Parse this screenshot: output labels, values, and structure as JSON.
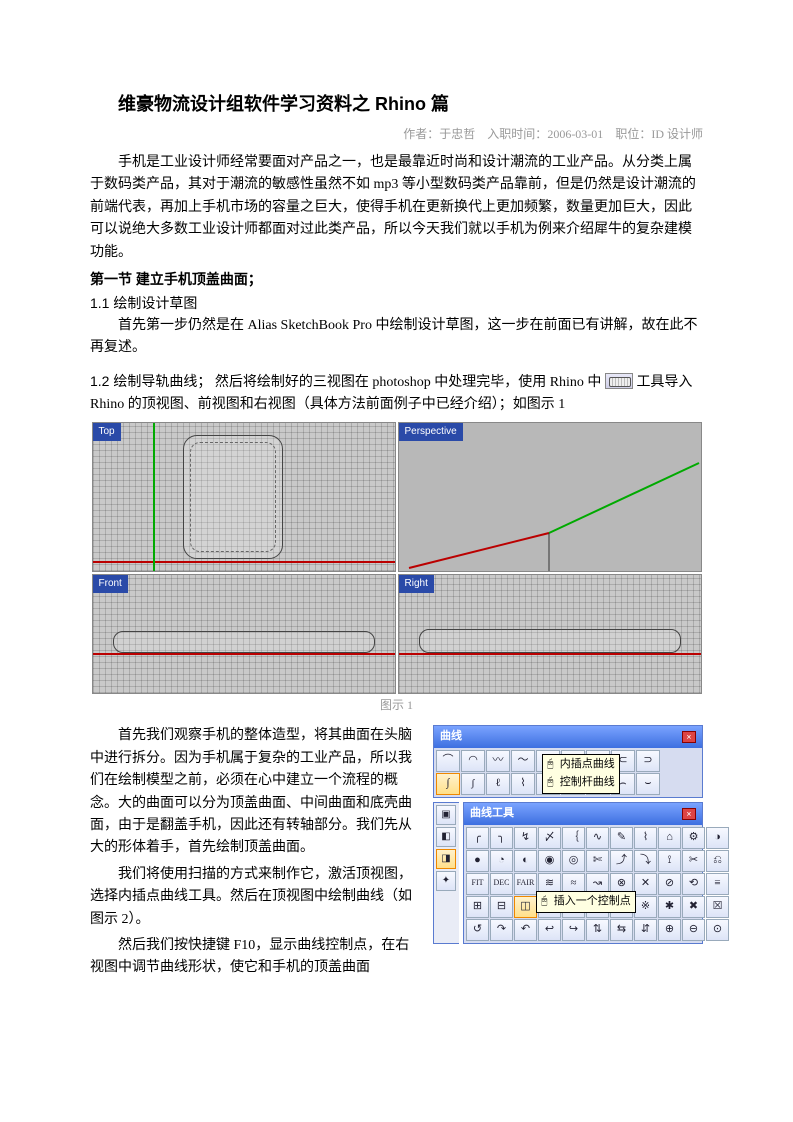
{
  "title": "维豪物流设计组软件学习资料之 Rhino 篇",
  "byline": {
    "author_label": "作者：",
    "author": "于忠哲",
    "join_label": "入职时间：",
    "join": "2006-03-01",
    "role_label": "职位：",
    "role": "ID 设计师"
  },
  "intro": "手机是工业设计师经常要面对产品之一，也是最靠近时尚和设计潮流的工业产品。从分类上属于数码类产品，其对于潮流的敏感性虽然不如 mp3 等小型数码类产品靠前，但是仍然是设计潮流的前端代表，再加上手机市场的容量之巨大，使得手机在更新换代上更加频繁，数量更加巨大，因此可以说绝大多数工业设计师都面对过此类产品，所以今天我们就以手机为例来介绍犀牛的复杂建模功能。",
  "section1": "第一节  建立手机顶盖曲面；",
  "s11_label": "1.1 绘制设计草图",
  "s11_text": "首先第一步仍然是在 Alias SketchBook Pro 中绘制设计草图，这一步在前面已有讲解，故在此不再复述。",
  "s12_lead": "1.2 绘制导轨曲线；",
  "s12_text_a": "然后将绘制好的三视图在 photoshop 中处理完毕，使用 Rhino 中",
  "s12_text_b": "工具导入 Rhino 的顶视图、前视图和右视图（具体方法前面例子中已经介绍）；如图示 1",
  "viewports": {
    "top": "Top",
    "persp": "Perspective",
    "front": "Front",
    "right": "Right"
  },
  "caption1": "图示 1",
  "para2": "首先我们观察手机的整体造型，将其曲面在头脑中进行拆分。因为手机属于复杂的工业产品，所以我们在绘制模型之前，必须在心中建立一个流程的概念。大的曲面可以分为顶盖曲面、中间曲面和底壳曲面，由于是翻盖手机，因此还有转轴部分。我们先从大的形体着手，首先绘制顶盖曲面。",
  "para3": "我们将使用扫描的方式来制作它，激活顶视图，选择内插点曲线工具。然后在顶视图中绘制曲线（如图示 2）。",
  "para4": "然后我们按快捷键 F10，显示曲线控制点，在右视图中调节曲线形状，使它和手机的顶盖曲面",
  "panel_curve": {
    "title": "曲线",
    "tooltip_interp": "内插点曲线",
    "tooltip_ctrl": "控制杆曲线",
    "icons": [
      "⌒",
      "◠",
      "〰",
      "〜",
      "◡",
      "∿",
      "◯",
      "⊂",
      "⊃",
      "∫",
      "ʃ",
      "ℓ",
      "⌇",
      "∩",
      "∪",
      "⊓",
      "⌢",
      "⌣"
    ]
  },
  "panel_tools": {
    "title": "曲线工具",
    "tooltip_insert": "插入一个控制点",
    "labels": {
      "fit": "FIT",
      "dec": "DEC",
      "fair": "FAIR"
    },
    "icons_row1": [
      "╭",
      "╮",
      "↯",
      "〆",
      "｛",
      "∿",
      "✎",
      "⌇",
      "⌂",
      "⚙",
      "◑"
    ],
    "icons_row2": [
      "●",
      "◔",
      "◐",
      "◉",
      "◎",
      "✄",
      "⤴",
      "⤵",
      "⟟",
      "✂",
      "⎌"
    ],
    "icons_row3": [
      "FIT",
      "DEC",
      "FAIR",
      "≋",
      "≈",
      "↝",
      "⊗",
      "✕",
      "⊘",
      "⟲",
      "≡"
    ],
    "icons_row4": [
      "⊞",
      "⊟",
      "◫",
      "⊡",
      "⊠",
      "⟐",
      "⟡",
      "※",
      "✱",
      "✖",
      "☒"
    ],
    "icons_row5": [
      "↺",
      "↷",
      "↶",
      "↩",
      "↪",
      "⇅",
      "⇆",
      "⇵",
      "⊕",
      "⊖",
      "⊙"
    ],
    "side": [
      "▣",
      "◧",
      "◨",
      "✦"
    ]
  }
}
